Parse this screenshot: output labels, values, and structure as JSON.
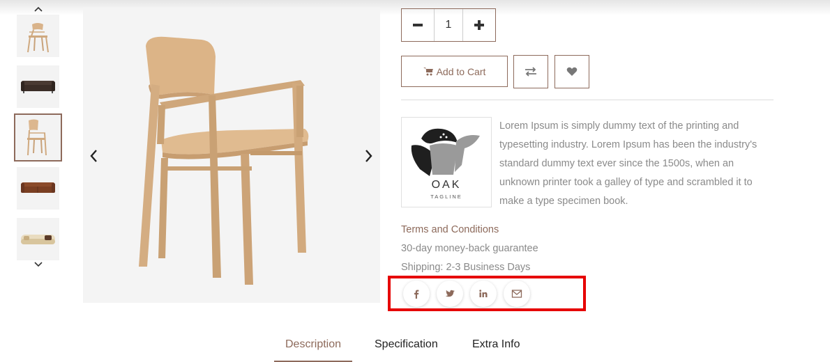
{
  "gallery": {
    "thumbnails": [
      {
        "name": "chair",
        "active": false
      },
      {
        "name": "sofa-dark",
        "active": false
      },
      {
        "name": "chair",
        "active": true
      },
      {
        "name": "sofa-brown",
        "active": false
      },
      {
        "name": "sofa-cream",
        "active": false
      }
    ],
    "up_icon": "chevron-up-icon",
    "down_icon": "chevron-down-icon",
    "prev_icon": "chevron-left-icon",
    "next_icon": "chevron-right-icon"
  },
  "quantity": {
    "value": "1",
    "minus_icon": "minus-icon",
    "plus_icon": "plus-icon"
  },
  "actions": {
    "add_to_cart": "Add to Cart",
    "cart_icon": "shopping-cart-icon",
    "compare_icon": "compare-arrows-icon",
    "wishlist_icon": "heart-icon"
  },
  "brand": {
    "logo_name": "OAK",
    "logo_tagline": "TAGLINE",
    "description": "Lorem Ipsum is simply dummy text of the printing and typesetting industry. Lorem Ipsum has been the industry's standard dummy text ever since the 1500s, when an unknown printer took a galley of type and scrambled it to make a type specimen book."
  },
  "info": {
    "terms": "Terms and Conditions",
    "guarantee": "30-day money-back guarantee",
    "shipping": "Shipping: 2-3 Business Days"
  },
  "share": {
    "icons": [
      "facebook-icon",
      "twitter-icon",
      "linkedin-icon",
      "email-icon"
    ]
  },
  "tabs": [
    {
      "label": "Description",
      "active": true
    },
    {
      "label": "Specification",
      "active": false
    },
    {
      "label": "Extra Info",
      "active": false
    }
  ],
  "colors": {
    "accent": "#8d6a5b",
    "highlight": "#e60000",
    "text_muted": "#8a8a8a"
  }
}
